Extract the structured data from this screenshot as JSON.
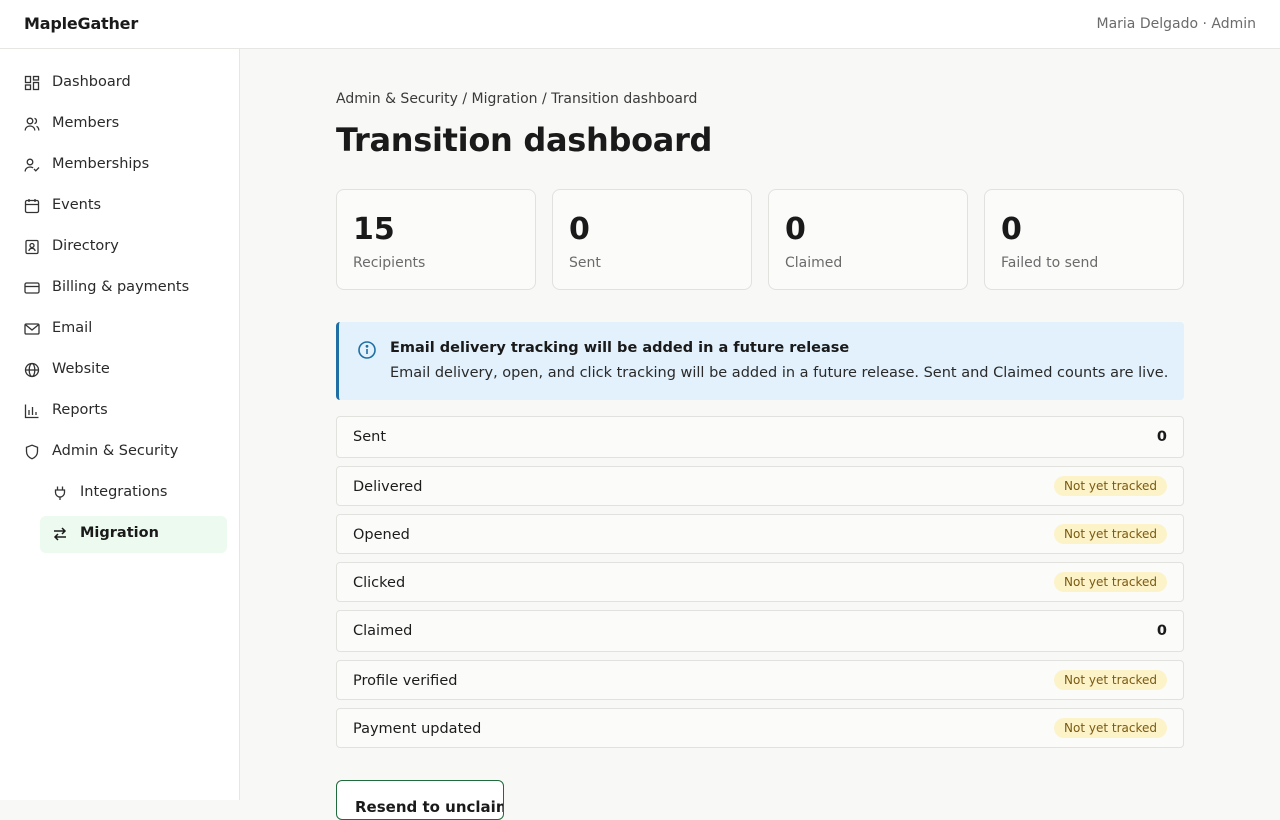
{
  "app": {
    "brand": "MapleGather",
    "user": "Maria Delgado · Admin"
  },
  "sidebar": {
    "items": [
      {
        "label": "Dashboard",
        "icon": "dashboard-icon"
      },
      {
        "label": "Members",
        "icon": "members-icon"
      },
      {
        "label": "Memberships",
        "icon": "memberships-icon"
      },
      {
        "label": "Events",
        "icon": "calendar-icon"
      },
      {
        "label": "Directory",
        "icon": "directory-icon"
      },
      {
        "label": "Billing & payments",
        "icon": "credit-card-icon"
      },
      {
        "label": "Email",
        "icon": "mail-icon"
      },
      {
        "label": "Website",
        "icon": "globe-icon"
      },
      {
        "label": "Reports",
        "icon": "bar-chart-icon"
      },
      {
        "label": "Admin & Security",
        "icon": "shield-icon"
      }
    ],
    "subitems": [
      {
        "label": "Integrations",
        "icon": "plug-icon"
      },
      {
        "label": "Migration",
        "icon": "swap-arrows-icon",
        "active": true
      }
    ]
  },
  "breadcrumb": "Admin & Security / Migration / Transition dashboard",
  "page_title": "Transition dashboard",
  "stats": [
    {
      "value": "15",
      "label": "Recipients"
    },
    {
      "value": "0",
      "label": "Sent"
    },
    {
      "value": "0",
      "label": "Claimed"
    },
    {
      "value": "0",
      "label": "Failed to send"
    }
  ],
  "notice": {
    "icon": "info-icon",
    "title": "Email delivery tracking will be added in a future release",
    "body": "Email delivery, open, and click tracking will be added in a future release. Sent and Claimed counts are live."
  },
  "funnel": [
    {
      "label": "Sent",
      "value": "0"
    },
    {
      "label": "Delivered",
      "badge": "Not yet tracked"
    },
    {
      "label": "Opened",
      "badge": "Not yet tracked"
    },
    {
      "label": "Clicked",
      "badge": "Not yet tracked"
    },
    {
      "label": "Claimed",
      "value": "0"
    },
    {
      "label": "Profile verified",
      "badge": "Not yet tracked"
    },
    {
      "label": "Payment updated",
      "badge": "Not yet tracked"
    }
  ],
  "cta_label": "Resend to unclaimed",
  "colors": {
    "accent": "#1f6b3c",
    "active_bg": "#ecfaf0",
    "info_bg": "#e2f1fc",
    "info_border": "#1f6fa5",
    "badge_bg": "#fcf3c9",
    "badge_text": "#7b5a12"
  }
}
